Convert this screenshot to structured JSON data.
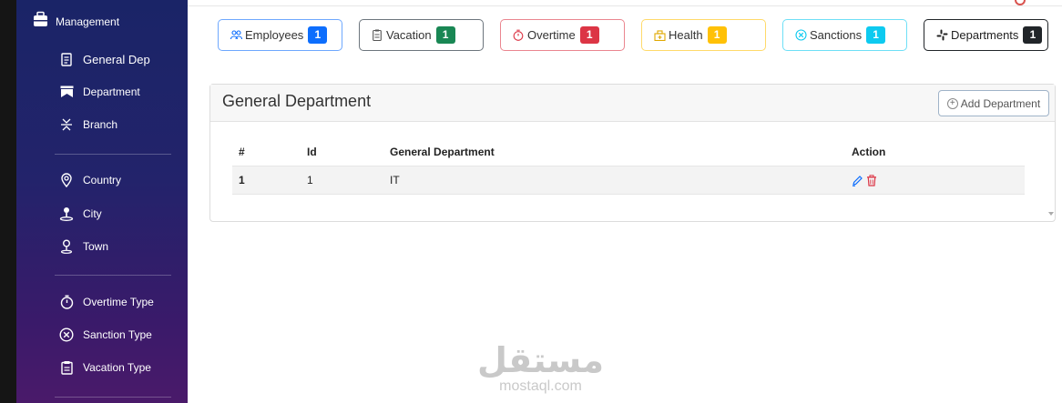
{
  "sidebar": {
    "header_label": "Management",
    "items": [
      {
        "label": "General Dep",
        "icon": "document-icon"
      },
      {
        "label": "Department",
        "icon": "bookmark-icon"
      },
      {
        "label": "Branch",
        "icon": "branch-icon"
      },
      {
        "label": "Country",
        "icon": "location-pin-icon"
      },
      {
        "label": "City",
        "icon": "person-pin-icon"
      },
      {
        "label": "Town",
        "icon": "map-pin-icon"
      },
      {
        "label": "Overtime Type",
        "icon": "stopwatch-icon"
      },
      {
        "label": "Sanction Type",
        "icon": "x-circle-icon"
      },
      {
        "label": "Vacation Type",
        "icon": "calendar-icon"
      }
    ]
  },
  "tabs": [
    {
      "label": "Employees",
      "count": "1",
      "color": "#0d6efd",
      "icon": "people-icon"
    },
    {
      "label": "Vacation",
      "count": "1",
      "color": "#198754",
      "icon": "clipboard-icon"
    },
    {
      "label": "Overtime",
      "count": "1",
      "color": "#dc3545",
      "icon": "stopwatch-icon"
    },
    {
      "label": "Health",
      "count": "1",
      "color": "#ffc107",
      "icon": "hospital-icon"
    },
    {
      "label": "Sanctions",
      "count": "1",
      "color": "#0dcaf0",
      "icon": "x-circle-icon"
    },
    {
      "label": "Departments",
      "count": "1",
      "color": "#212529",
      "icon": "slack-icon"
    }
  ],
  "card": {
    "title": "General Department",
    "add_button": "Add Department"
  },
  "table": {
    "headers": [
      "#",
      "Id",
      "General Department",
      "Action"
    ],
    "rows": [
      {
        "num": "1",
        "id": "1",
        "name": "IT"
      }
    ]
  },
  "watermark": {
    "arabic": "مستقل",
    "latin": "mostaql.com"
  }
}
